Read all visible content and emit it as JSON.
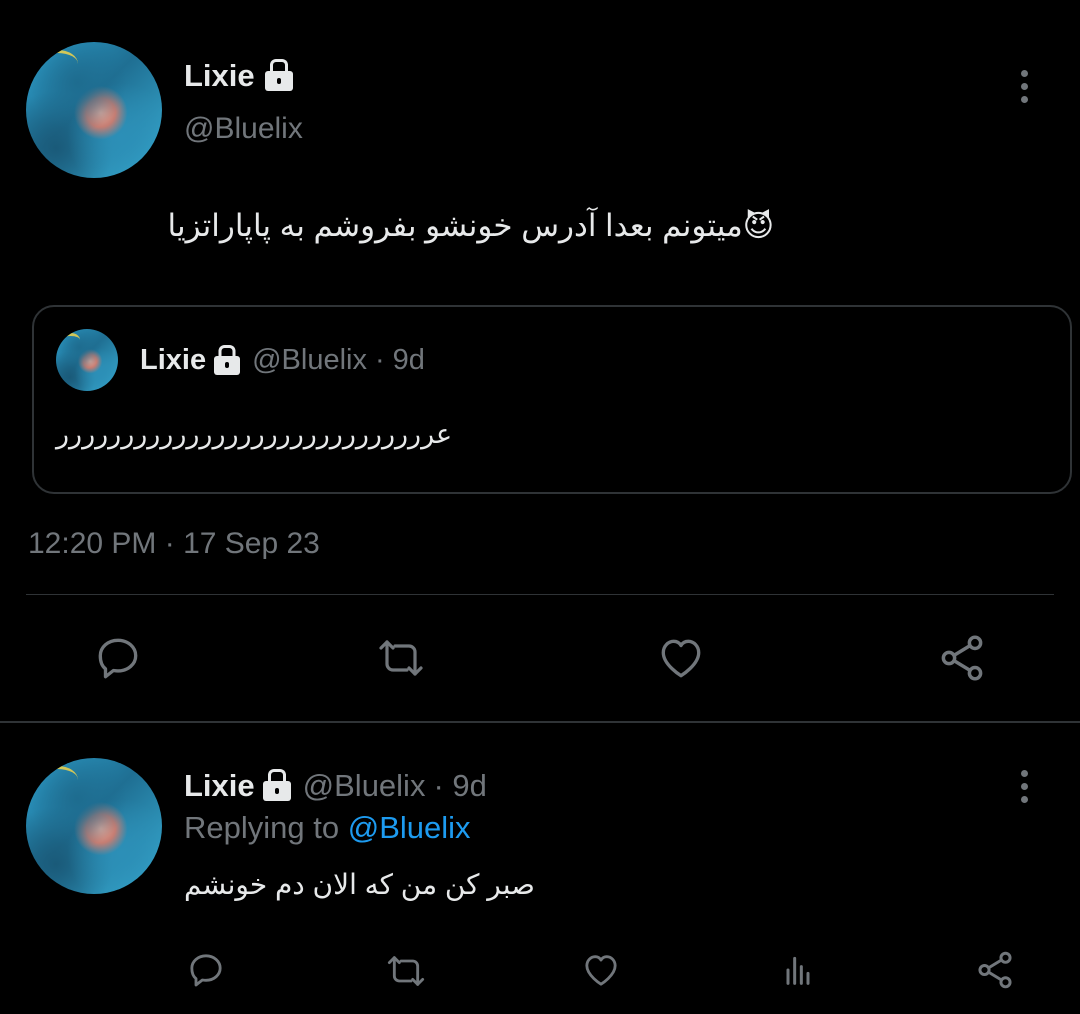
{
  "main_tweet": {
    "display_name": "Lixie",
    "handle": "@Bluelix",
    "text": "میتونم بعدا آدرس خونشو بفروشم به پاپاراتزیا",
    "emoji": "😈",
    "timestamp": "12:20 PM · 17 Sep 23"
  },
  "quoted_tweet": {
    "display_name": "Lixie",
    "handle": "@Bluelix",
    "age": "· 9d",
    "text": "عررررررررررررررررررررررررررررر"
  },
  "reply_tweet": {
    "display_name": "Lixie",
    "handle": "@Bluelix",
    "age": "· 9d",
    "replying_prefix": "Replying to",
    "replying_to": "@Bluelix",
    "text": "صبر کن من که الان دم خونشم"
  },
  "icons": {
    "more": "more-vertical-icon",
    "reply": "reply-icon",
    "retweet": "retweet-icon",
    "like": "heart-icon",
    "share": "share-icon",
    "analytics": "analytics-icon",
    "lock": "lock-icon"
  },
  "colors": {
    "background": "#000000",
    "text": "#e7e9ea",
    "muted": "#71767b",
    "link": "#1d9bf0",
    "border": "#2f3336"
  }
}
